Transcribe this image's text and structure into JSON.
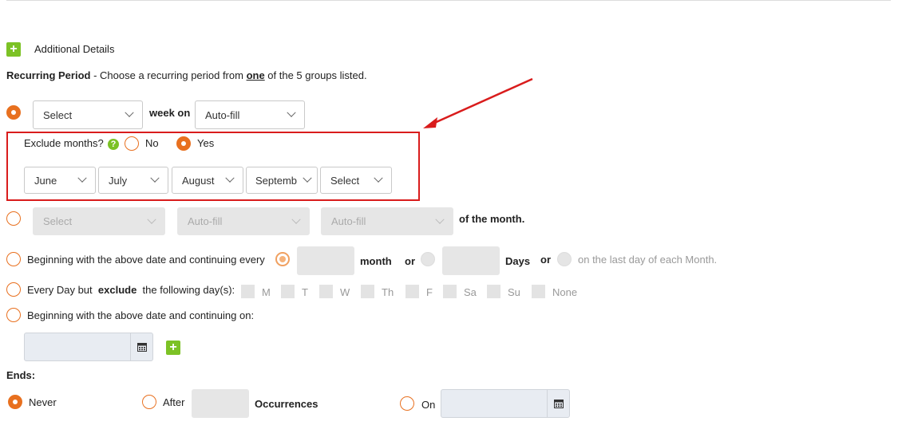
{
  "section": {
    "title": "Additional Details"
  },
  "recurring": {
    "label": "Recurring Period",
    "desc_pre": " - Choose a recurring period from ",
    "desc_em": "one",
    "desc_post": " of the 5 groups listed."
  },
  "group1": {
    "select_value": "Select",
    "week_on": "week on",
    "autofill_value": "Auto-fill",
    "exclude_label": "Exclude months?",
    "no": "No",
    "yes": "Yes",
    "months": [
      "June",
      "July",
      "August",
      "Septemb",
      "Select"
    ]
  },
  "group2": {
    "select": "Select",
    "auto1": "Auto-fill",
    "auto2": "Auto-fill",
    "suffix": "of the month."
  },
  "group3": {
    "label": "Beginning with the above date and continuing every",
    "month": "month",
    "or1": "or",
    "days": "Days",
    "or2": "or",
    "last_day": "on the last day of each Month."
  },
  "group4": {
    "pre": "Every Day but",
    "exclude": "exclude",
    "post": "the following day(s):",
    "days": [
      "M",
      "T",
      "W",
      "Th",
      "F",
      "Sa",
      "Su",
      "None"
    ]
  },
  "group5": {
    "label": "Beginning with the above date and continuing on:"
  },
  "ends": {
    "label": "Ends:",
    "never": "Never",
    "after": "After",
    "occurrences": "Occurrences",
    "on": "On"
  },
  "colors": {
    "accent": "#e8701f",
    "plus": "#7cc225",
    "annotation": "#d91c1c"
  },
  "icons": [
    "plus-icon",
    "help-icon",
    "calendar-icon",
    "chevron-down-icon",
    "arrow-annotation"
  ]
}
